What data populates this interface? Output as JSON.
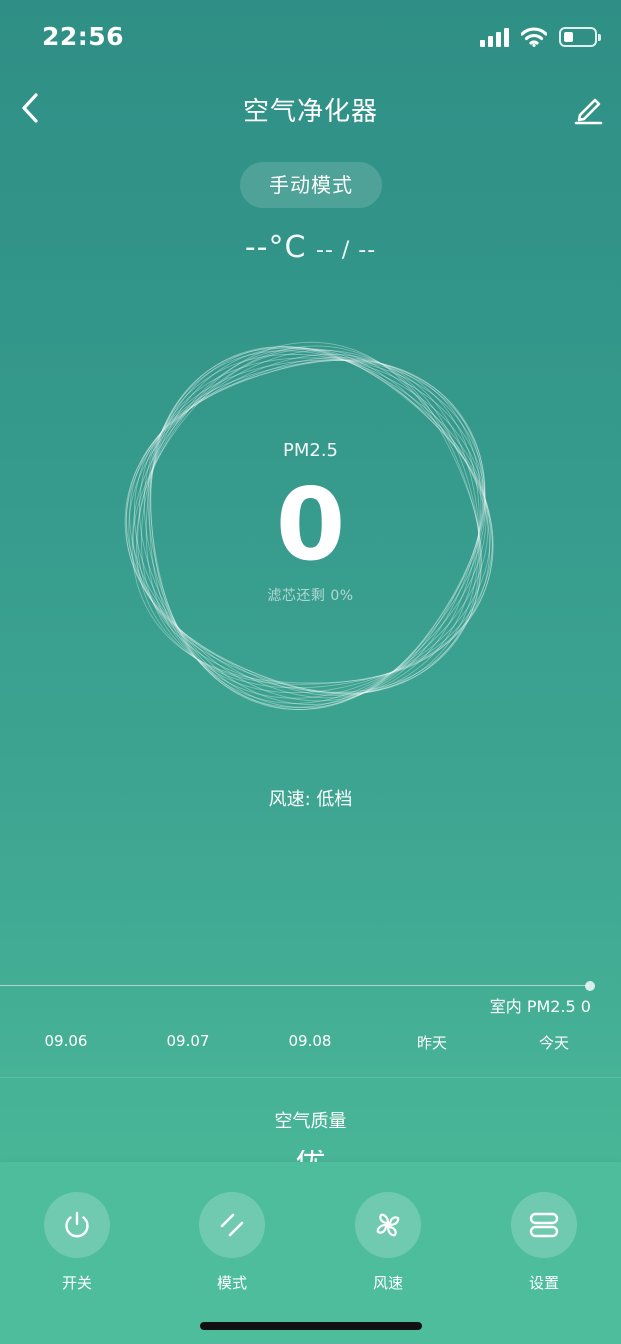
{
  "status_bar": {
    "time": "22:56",
    "battery_level_pct": 30,
    "icons": [
      "cellular-signal-icon",
      "wifi-icon",
      "battery-icon"
    ]
  },
  "nav": {
    "title": "空气净化器",
    "icons": [
      "back-chevron-icon",
      "edit-pencil-icon"
    ]
  },
  "status": {
    "mode": "手动模式",
    "temperature": "--°C",
    "humidity": "-- / --"
  },
  "gauge": {
    "label": "PM2.5",
    "value": "0",
    "filter_text": "滤芯还剩 0%"
  },
  "fan_speed_text": "风速: 低档",
  "history_chart": {
    "indoor_label": "室内 PM2.5 0",
    "dates": [
      "09.06",
      "09.07",
      "09.08",
      "昨天",
      "今天"
    ]
  },
  "air_quality": {
    "label": "空气质量",
    "value": "优"
  },
  "controls": [
    {
      "label": "开关",
      "icon": "power-icon"
    },
    {
      "label": "模式",
      "icon": "mode-slashes-icon"
    },
    {
      "label": "风速",
      "icon": "fan-icon"
    },
    {
      "label": "设置",
      "icon": "settings-icon"
    }
  ],
  "colors": {
    "background_top": "#2f8f86",
    "background_bottom": "#4dbd9b",
    "bottom_bar": "#4dbd9c",
    "text": "#ffffff"
  }
}
